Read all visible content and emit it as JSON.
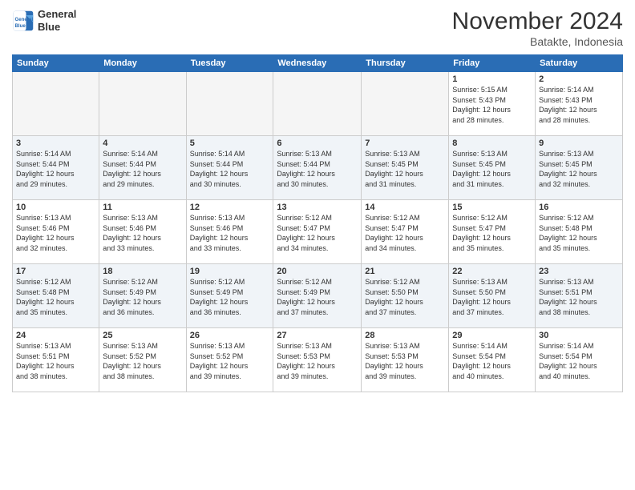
{
  "header": {
    "logo_line1": "General",
    "logo_line2": "Blue",
    "month_title": "November 2024",
    "location": "Batakte, Indonesia"
  },
  "weekdays": [
    "Sunday",
    "Monday",
    "Tuesday",
    "Wednesday",
    "Thursday",
    "Friday",
    "Saturday"
  ],
  "weeks": [
    [
      {
        "day": "",
        "info": ""
      },
      {
        "day": "",
        "info": ""
      },
      {
        "day": "",
        "info": ""
      },
      {
        "day": "",
        "info": ""
      },
      {
        "day": "",
        "info": ""
      },
      {
        "day": "1",
        "info": "Sunrise: 5:15 AM\nSunset: 5:43 PM\nDaylight: 12 hours\nand 28 minutes."
      },
      {
        "day": "2",
        "info": "Sunrise: 5:14 AM\nSunset: 5:43 PM\nDaylight: 12 hours\nand 28 minutes."
      }
    ],
    [
      {
        "day": "3",
        "info": "Sunrise: 5:14 AM\nSunset: 5:44 PM\nDaylight: 12 hours\nand 29 minutes."
      },
      {
        "day": "4",
        "info": "Sunrise: 5:14 AM\nSunset: 5:44 PM\nDaylight: 12 hours\nand 29 minutes."
      },
      {
        "day": "5",
        "info": "Sunrise: 5:14 AM\nSunset: 5:44 PM\nDaylight: 12 hours\nand 30 minutes."
      },
      {
        "day": "6",
        "info": "Sunrise: 5:13 AM\nSunset: 5:44 PM\nDaylight: 12 hours\nand 30 minutes."
      },
      {
        "day": "7",
        "info": "Sunrise: 5:13 AM\nSunset: 5:45 PM\nDaylight: 12 hours\nand 31 minutes."
      },
      {
        "day": "8",
        "info": "Sunrise: 5:13 AM\nSunset: 5:45 PM\nDaylight: 12 hours\nand 31 minutes."
      },
      {
        "day": "9",
        "info": "Sunrise: 5:13 AM\nSunset: 5:45 PM\nDaylight: 12 hours\nand 32 minutes."
      }
    ],
    [
      {
        "day": "10",
        "info": "Sunrise: 5:13 AM\nSunset: 5:46 PM\nDaylight: 12 hours\nand 32 minutes."
      },
      {
        "day": "11",
        "info": "Sunrise: 5:13 AM\nSunset: 5:46 PM\nDaylight: 12 hours\nand 33 minutes."
      },
      {
        "day": "12",
        "info": "Sunrise: 5:13 AM\nSunset: 5:46 PM\nDaylight: 12 hours\nand 33 minutes."
      },
      {
        "day": "13",
        "info": "Sunrise: 5:12 AM\nSunset: 5:47 PM\nDaylight: 12 hours\nand 34 minutes."
      },
      {
        "day": "14",
        "info": "Sunrise: 5:12 AM\nSunset: 5:47 PM\nDaylight: 12 hours\nand 34 minutes."
      },
      {
        "day": "15",
        "info": "Sunrise: 5:12 AM\nSunset: 5:47 PM\nDaylight: 12 hours\nand 35 minutes."
      },
      {
        "day": "16",
        "info": "Sunrise: 5:12 AM\nSunset: 5:48 PM\nDaylight: 12 hours\nand 35 minutes."
      }
    ],
    [
      {
        "day": "17",
        "info": "Sunrise: 5:12 AM\nSunset: 5:48 PM\nDaylight: 12 hours\nand 35 minutes."
      },
      {
        "day": "18",
        "info": "Sunrise: 5:12 AM\nSunset: 5:49 PM\nDaylight: 12 hours\nand 36 minutes."
      },
      {
        "day": "19",
        "info": "Sunrise: 5:12 AM\nSunset: 5:49 PM\nDaylight: 12 hours\nand 36 minutes."
      },
      {
        "day": "20",
        "info": "Sunrise: 5:12 AM\nSunset: 5:49 PM\nDaylight: 12 hours\nand 37 minutes."
      },
      {
        "day": "21",
        "info": "Sunrise: 5:12 AM\nSunset: 5:50 PM\nDaylight: 12 hours\nand 37 minutes."
      },
      {
        "day": "22",
        "info": "Sunrise: 5:13 AM\nSunset: 5:50 PM\nDaylight: 12 hours\nand 37 minutes."
      },
      {
        "day": "23",
        "info": "Sunrise: 5:13 AM\nSunset: 5:51 PM\nDaylight: 12 hours\nand 38 minutes."
      }
    ],
    [
      {
        "day": "24",
        "info": "Sunrise: 5:13 AM\nSunset: 5:51 PM\nDaylight: 12 hours\nand 38 minutes."
      },
      {
        "day": "25",
        "info": "Sunrise: 5:13 AM\nSunset: 5:52 PM\nDaylight: 12 hours\nand 38 minutes."
      },
      {
        "day": "26",
        "info": "Sunrise: 5:13 AM\nSunset: 5:52 PM\nDaylight: 12 hours\nand 39 minutes."
      },
      {
        "day": "27",
        "info": "Sunrise: 5:13 AM\nSunset: 5:53 PM\nDaylight: 12 hours\nand 39 minutes."
      },
      {
        "day": "28",
        "info": "Sunrise: 5:13 AM\nSunset: 5:53 PM\nDaylight: 12 hours\nand 39 minutes."
      },
      {
        "day": "29",
        "info": "Sunrise: 5:14 AM\nSunset: 5:54 PM\nDaylight: 12 hours\nand 40 minutes."
      },
      {
        "day": "30",
        "info": "Sunrise: 5:14 AM\nSunset: 5:54 PM\nDaylight: 12 hours\nand 40 minutes."
      }
    ]
  ]
}
